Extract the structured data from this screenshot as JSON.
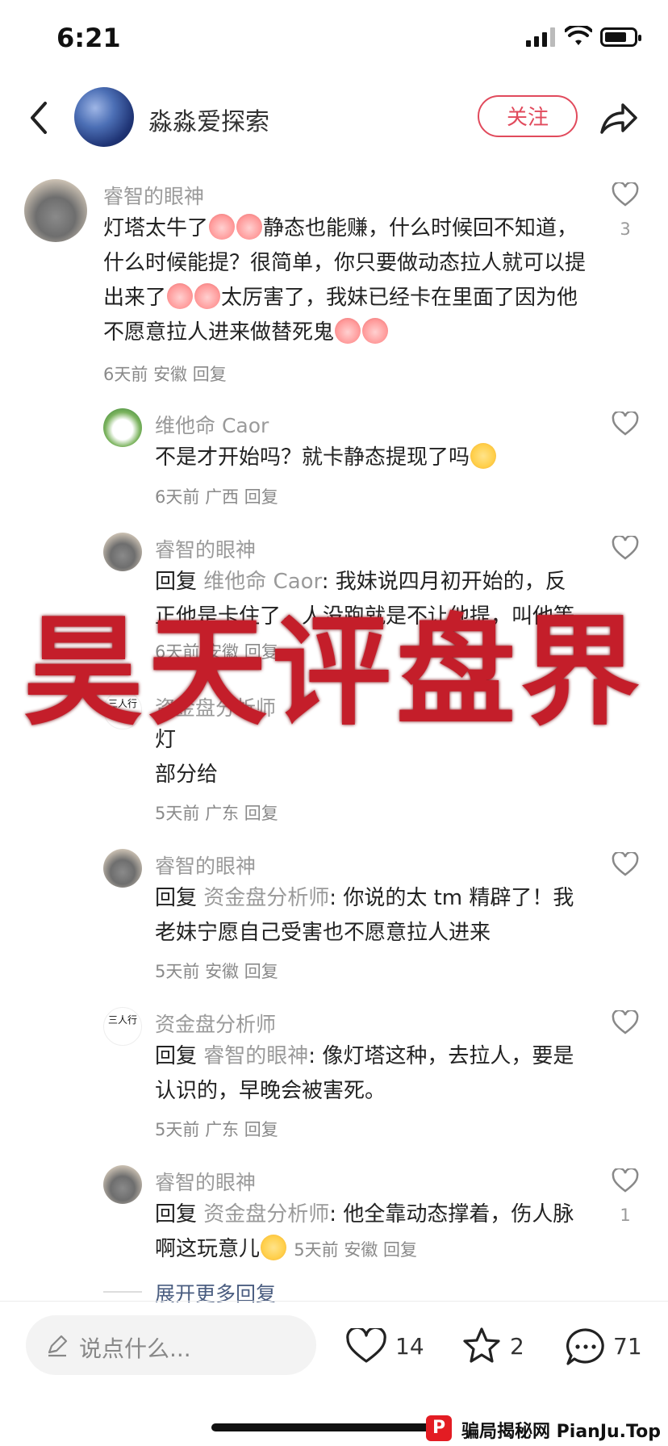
{
  "status_bar": {
    "time": "6:21"
  },
  "header": {
    "author": "淼淼爱探索",
    "follow_label": "关注"
  },
  "comments": [
    {
      "user": "睿智的眼神",
      "text_parts": [
        "灯塔太牛了",
        "静态也能赚，什么时候回不知道，什么时候能提？很简单，你只要做动态拉人就可以提出来了",
        "太厉害了，我妹已经卡在里面了因为他不愿意拉人进来做替死鬼"
      ],
      "time": "6天前",
      "region": "安徽",
      "reply_label": "回复",
      "likes": "3"
    },
    {
      "user": "维他命 Caor",
      "text": "不是才开始吗？就卡静态提现了吗",
      "time": "6天前",
      "region": "广西",
      "reply_label": "回复"
    },
    {
      "user": "睿智的眼神",
      "reply_prefix": "回复",
      "reply_to": "维他命 Caor",
      "text": ": 我妹说四月初开始的，反正他是卡住了，人没跑就是不让他提，叫他等",
      "time": "6天前",
      "region": "安徽",
      "reply_label": "回复"
    },
    {
      "user": "资金盘分析师",
      "text_line1": "灯",
      "text_line2": "部分给",
      "time": "5天前",
      "region": "广东",
      "reply_label": "回复"
    },
    {
      "user": "睿智的眼神",
      "reply_prefix": "回复",
      "reply_to": "资金盘分析师",
      "text": ": 你说的太 tm 精辟了！我老妹宁愿自己受害也不愿意拉人进来",
      "time": "5天前",
      "region": "安徽",
      "reply_label": "回复"
    },
    {
      "user": "资金盘分析师",
      "reply_prefix": "回复",
      "reply_to": "睿智的眼神",
      "text": ": 像灯塔这种，去拉人，要是认识的，早晚会被害死。",
      "time": "5天前",
      "region": "广东",
      "reply_label": "回复"
    },
    {
      "user": "睿智的眼神",
      "reply_prefix": "回复",
      "reply_to": "资金盘分析师",
      "text": ": 他全靠动态撑着，伤人脉啊这玩意儿",
      "time": "5天前",
      "region": "安徽",
      "reply_label": "回复",
      "likes": "1"
    }
  ],
  "logo_text": "三人行",
  "expand_more": "展开更多回复",
  "watermark": "昊天评盘界",
  "bottom_bar": {
    "input_placeholder": "说点什么...",
    "likes": "14",
    "stars": "2",
    "comments": "71"
  },
  "site_badge": {
    "icon_letter": "P",
    "text": "骗局揭秘网 PianJu.Top"
  }
}
